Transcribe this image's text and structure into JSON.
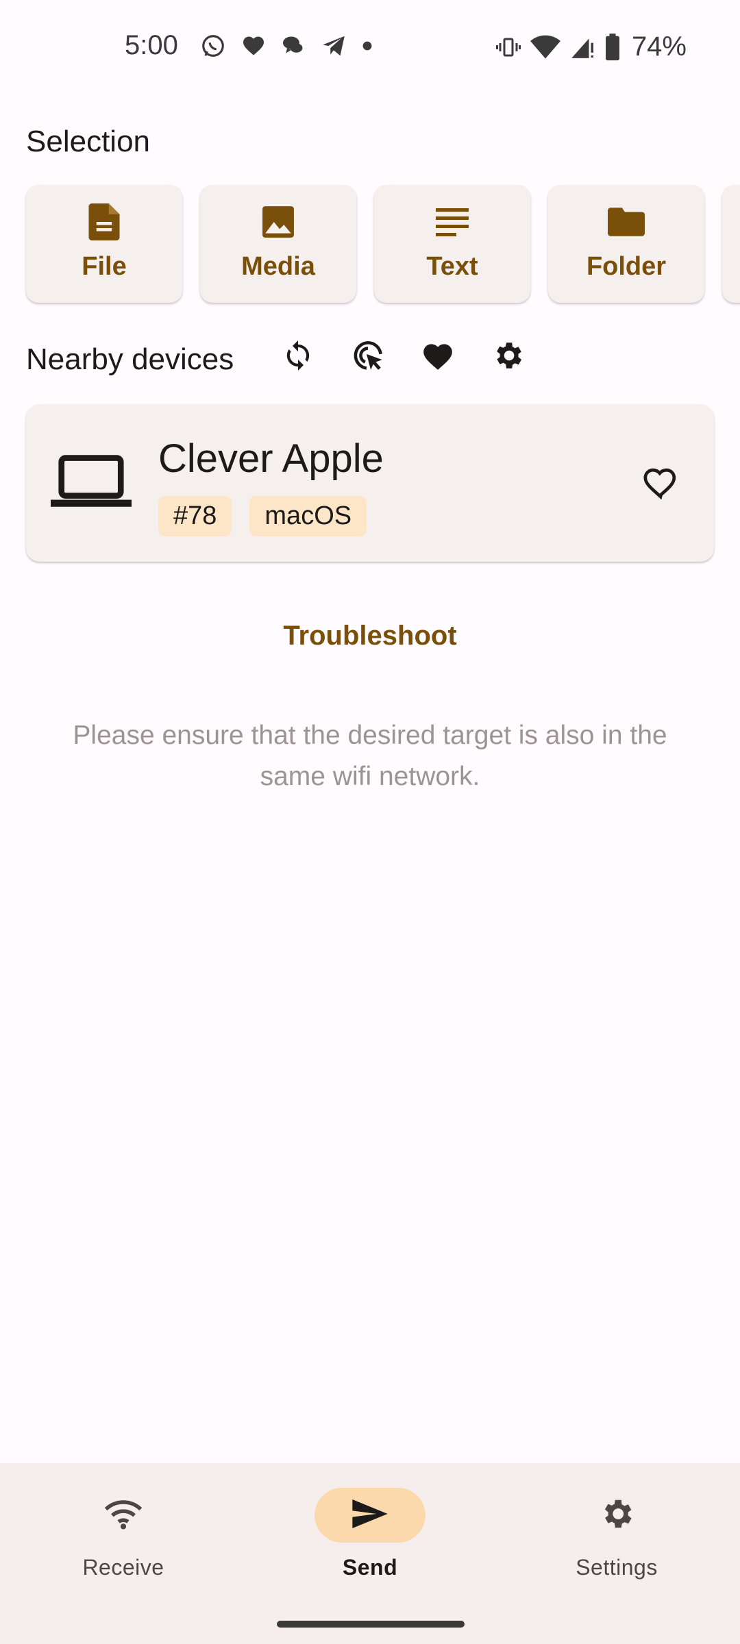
{
  "status_bar": {
    "time": "5:00",
    "battery": "74%",
    "left_icons": [
      "whatsapp-icon",
      "heart-icon",
      "chat-bubbles-icon",
      "telegram-icon",
      "dot-icon"
    ],
    "right_icons": [
      "vibrate-icon",
      "wifi-icon",
      "signal-icon",
      "battery-icon"
    ]
  },
  "selection": {
    "title": "Selection",
    "items": [
      {
        "label": "File",
        "icon": "file-icon"
      },
      {
        "label": "Media",
        "icon": "image-icon"
      },
      {
        "label": "Text",
        "icon": "text-icon"
      },
      {
        "label": "Folder",
        "icon": "folder-icon"
      }
    ]
  },
  "nearby": {
    "title": "Nearby devices",
    "tools": [
      "refresh-icon",
      "target-cursor-icon",
      "favorite-heart-icon",
      "settings-icon"
    ]
  },
  "device": {
    "name": "Clever Apple",
    "badges": [
      "#78",
      "macOS"
    ],
    "icon": "laptop-icon"
  },
  "troubleshoot_label": "Troubleshoot",
  "hint": "Please ensure that the desired target is also in the same wifi network.",
  "bottom_nav": {
    "items": [
      {
        "label": "Receive",
        "icon": "wifi-icon",
        "active": false
      },
      {
        "label": "Send",
        "icon": "send-icon",
        "active": true
      },
      {
        "label": "Settings",
        "icon": "settings-icon",
        "active": false
      }
    ]
  },
  "colors": {
    "accent": "#7a4f0a",
    "card_bg": "#f5f0ed",
    "badge_bg": "#fde6c8",
    "active_pill": "#fcd9ad",
    "background": "#fffbfe"
  }
}
